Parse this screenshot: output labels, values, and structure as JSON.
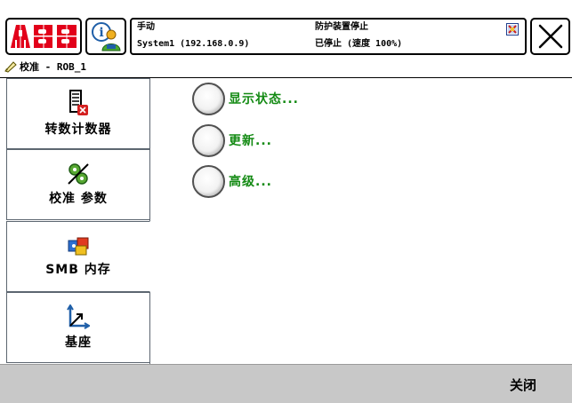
{
  "brand": {
    "logo_text": "ABB",
    "logo_color": "#e2001a"
  },
  "status": {
    "mode": "手动",
    "system": "System1 (192.168.0.9)",
    "guard_stop": "防护装置停止",
    "state": "已停止 (速度 100%)"
  },
  "breadcrumb": {
    "text": "校准 - ROB_1"
  },
  "tabs": [
    {
      "label": "转数计数器",
      "icon": "revolution-counter-icon"
    },
    {
      "label": "校准 参数",
      "icon": "calibration-parameters-icon"
    },
    {
      "label": "SMB 内存",
      "icon": "smb-memory-icon"
    },
    {
      "label": "基座",
      "icon": "base-frame-icon"
    }
  ],
  "active_tab_index": 2,
  "options": [
    {
      "label": "显示状态..."
    },
    {
      "label": "更新..."
    },
    {
      "label": "高级..."
    }
  ],
  "bottom": {
    "close_label": "关闭"
  },
  "colors": {
    "option_text": "#138a13",
    "bottom_bar": "#c8c8c8",
    "tab_border": "#5c6670"
  }
}
